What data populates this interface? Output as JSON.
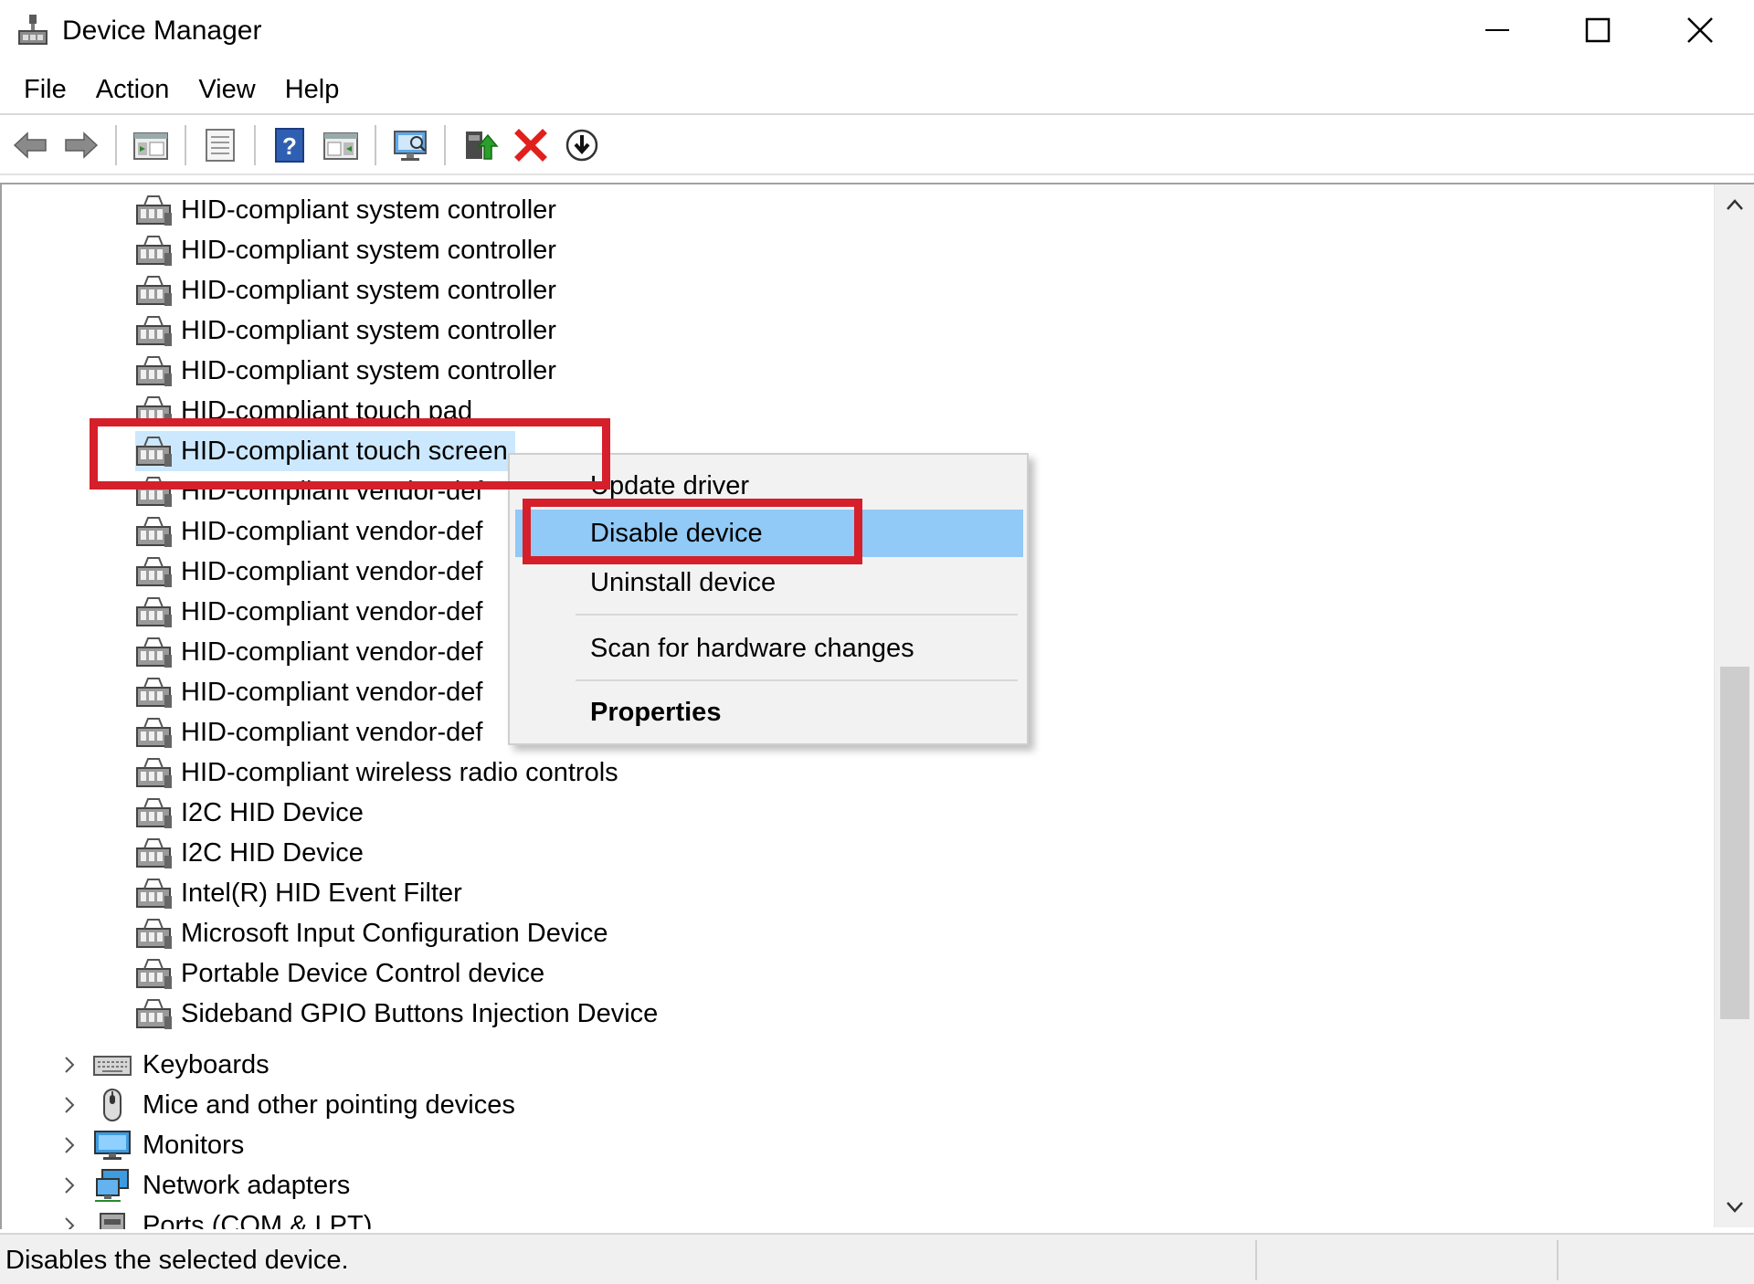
{
  "window": {
    "title": "Device Manager",
    "controls": [
      "minimize",
      "maximize",
      "close"
    ]
  },
  "menu": [
    "File",
    "Action",
    "View",
    "Help"
  ],
  "toolbar": {
    "buttons": [
      "back-icon",
      "forward-icon",
      "show-hide-tree-icon",
      "properties-icon",
      "help-icon",
      "view-icon",
      "scan-hardware-icon",
      "update-driver-icon",
      "uninstall-icon",
      "enable-device-icon"
    ]
  },
  "tree": {
    "devices": [
      "HID-compliant system controller",
      "HID-compliant system controller",
      "HID-compliant system controller",
      "HID-compliant system controller",
      "HID-compliant system controller",
      "HID-compliant touch pad",
      "HID-compliant touch screen",
      "HID-compliant vendor-def",
      "HID-compliant vendor-def",
      "HID-compliant vendor-def",
      "HID-compliant vendor-def",
      "HID-compliant vendor-def",
      "HID-compliant vendor-def",
      "HID-compliant vendor-def",
      "HID-compliant wireless radio controls",
      "I2C HID Device",
      "I2C HID Device",
      "Intel(R) HID Event Filter",
      "Microsoft Input Configuration Device",
      "Portable Device Control device",
      "Sideband GPIO Buttons Injection Device"
    ],
    "selected_device": "HID-compliant touch screen",
    "categories": [
      "Keyboards",
      "Mice and other pointing devices",
      "Monitors",
      "Network adapters",
      "Ports (COM & LPT)"
    ]
  },
  "context_menu": {
    "items": [
      {
        "label": "Update driver"
      },
      {
        "label": "Disable device",
        "highlighted": true
      },
      {
        "label": "Uninstall device"
      },
      {
        "label": "Scan for hardware changes"
      },
      {
        "label": "Properties",
        "bold": true
      }
    ]
  },
  "status_bar": {
    "text": "Disables the selected device."
  },
  "colors": {
    "highlight_box": "#d51f2b",
    "menu_hover": "#91c9f7",
    "selection": "#cce8ff"
  }
}
